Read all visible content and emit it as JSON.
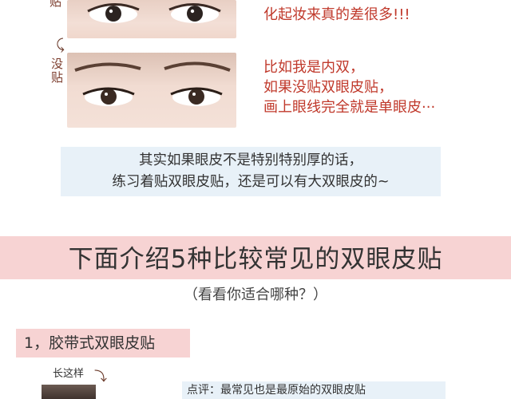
{
  "top": {
    "label_partial": "贴",
    "caption": "化起妆来真的差很多!!!"
  },
  "middle": {
    "label": "没贴",
    "caption_lines": [
      "比如我是内双，",
      "如果没贴双眼皮贴，",
      "画上眼线完全就是单眼皮···"
    ]
  },
  "tip": {
    "line1": "其实如果眼皮不是特别特别厚的话，",
    "line2": "练习着贴双眼皮贴，还是可以有大双眼皮的~"
  },
  "banner": {
    "title": "下面介绍5种比较常见的双眼皮贴",
    "subtitle": "（看看你适合哪种？）"
  },
  "section1": {
    "tag": "1，胶带式双眼皮贴",
    "looks_label": "长这样",
    "review": "点评：最常见也是最原始的双眼皮贴"
  },
  "icons": {
    "arrow_top": "curved-arrow-icon",
    "arrow_looks": "curved-arrow-icon"
  },
  "colors": {
    "caption": "#c0392b",
    "banner": "#f7d3d3",
    "tip_box": "#e8f1f8"
  }
}
